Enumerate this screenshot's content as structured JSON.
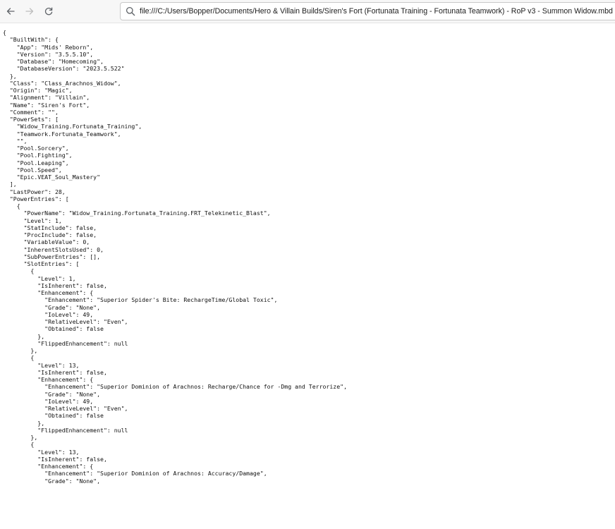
{
  "browser": {
    "address": "file:///C:/Users/Bopper/Documents/Hero & Villain Builds/Siren's Fort (Fortunata Training - Fortunata Teamwork) - RoP v3 - Summon Widow.mbd",
    "nav_icons": {
      "back": "arrow-left-icon",
      "forward": "arrow-right-icon",
      "reload": "reload-icon",
      "search": "search-icon"
    }
  },
  "document": {
    "lines": [
      "{",
      "  \"BuiltWith\": {",
      "    \"App\": \"Mids' Reborn\",",
      "    \"Version\": \"3.5.5.10\",",
      "    \"Database\": \"Homecoming\",",
      "    \"DatabaseVersion\": \"2023.5.522\"",
      "  },",
      "  \"Class\": \"Class_Arachnos_Widow\",",
      "  \"Origin\": \"Magic\",",
      "  \"Alignment\": \"Villain\",",
      "  \"Name\": \"Siren's Fort\",",
      "  \"Comment\": \"\",",
      "  \"PowerSets\": [",
      "    \"Widow_Training.Fortunata_Training\",",
      "    \"Teamwork.Fortunata_Teamwork\",",
      "    \"\",",
      "    \"Pool.Sorcery\",",
      "    \"Pool.Fighting\",",
      "    \"Pool.Leaping\",",
      "    \"Pool.Speed\",",
      "    \"Epic.VEAT_Soul_Mastery\"",
      "  ],",
      "  \"LastPower\": 28,",
      "  \"PowerEntries\": [",
      "    {",
      "      \"PowerName\": \"Widow_Training.Fortunata_Training.FRT_Telekinetic_Blast\",",
      "      \"Level\": 1,",
      "      \"StatInclude\": false,",
      "      \"ProcInclude\": false,",
      "      \"VariableValue\": 0,",
      "      \"InherentSlotsUsed\": 0,",
      "      \"SubPowerEntries\": [],",
      "      \"SlotEntries\": [",
      "        {",
      "          \"Level\": 1,",
      "          \"IsInherent\": false,",
      "          \"Enhancement\": {",
      "            \"Enhancement\": \"Superior Spider's Bite: RechargeTime/Global Toxic\",",
      "            \"Grade\": \"None\",",
      "            \"IoLevel\": 49,",
      "            \"RelativeLevel\": \"Even\",",
      "            \"Obtained\": false",
      "          },",
      "          \"FlippedEnhancement\": null",
      "        },",
      "        {",
      "          \"Level\": 13,",
      "          \"IsInherent\": false,",
      "          \"Enhancement\": {",
      "            \"Enhancement\": \"Superior Dominion of Arachnos: Recharge/Chance for -Dmg and Terrorize\",",
      "            \"Grade\": \"None\",",
      "            \"IoLevel\": 49,",
      "            \"RelativeLevel\": \"Even\",",
      "            \"Obtained\": false",
      "          },",
      "          \"FlippedEnhancement\": null",
      "        },",
      "        {",
      "          \"Level\": 13,",
      "          \"IsInherent\": false,",
      "          \"Enhancement\": {",
      "            \"Enhancement\": \"Superior Dominion of Arachnos: Accuracy/Damage\",",
      "            \"Grade\": \"None\","
    ]
  },
  "colors": {
    "toolbar_bg": "#f7f7f7",
    "text": "#111111",
    "icon": "#5f6368",
    "icon_disabled": "#bdbdbd"
  }
}
